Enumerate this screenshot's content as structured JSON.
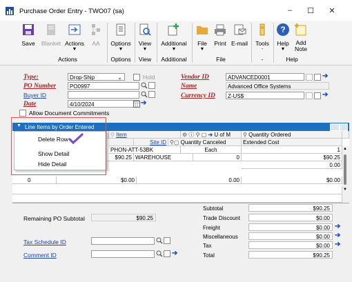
{
  "window": {
    "title": "Purchase Order Entry  -  TWO07 (sa)",
    "minimize": "–",
    "maximize": "☐",
    "close": "✕"
  },
  "ribbon": {
    "buttons": [
      {
        "label": "Save",
        "icon": "save-icon"
      },
      {
        "label": "Blanket",
        "icon": "blanket-icon"
      },
      {
        "label": "Actions",
        "icon": "actions-icon"
      },
      {
        "label": "AA",
        "icon": "aa-icon"
      },
      {
        "label": "Options",
        "icon": "options-icon"
      },
      {
        "label": "View",
        "icon": "view-icon"
      },
      {
        "label": "Additional",
        "icon": "additional-icon"
      },
      {
        "label": "File",
        "icon": "folder-icon"
      },
      {
        "label": "Print",
        "icon": "printer-icon"
      },
      {
        "label": "E-mail",
        "icon": "email-icon"
      },
      {
        "label": "Tools",
        "icon": "tools-icon"
      },
      {
        "label": "Help",
        "icon": "help-icon"
      },
      {
        "label": "Add Note",
        "icon": "add-note-icon"
      }
    ],
    "groups": [
      "Actions",
      "Options",
      "View",
      "Additional",
      "File",
      "-",
      "Help"
    ]
  },
  "header": {
    "type_label": "Type:",
    "type_value": "Drop-Ship",
    "hold_label": "Hold",
    "po_number_label": "PO Number",
    "po_number_value": "PO0997",
    "buyer_label": "Buyer ID",
    "buyer_value": "",
    "date_label": "Date",
    "date_value": "4/10/2024",
    "allow_commitments_label": "Allow Document Commitments",
    "vendor_label": "Vendor ID",
    "vendor_value": "ADVANCED0001",
    "name_label": "Name",
    "name_value": "Advanced Office Systems",
    "currency_label": "Currency ID",
    "currency_value": "Z-US$"
  },
  "grid": {
    "bar_title": "Line Items by Order Entered",
    "headers_row1": [
      "ID",
      "Item",
      "U of M",
      "Quantity Ordered"
    ],
    "headers_row2": [
      "Site ID",
      "Quantity Canceled",
      "Extended Cost"
    ],
    "rows": [
      {
        "item": "PHON-ATT-53BK",
        "uom": "Each",
        "qty": "1"
      },
      {
        "cost_left": "$90.25",
        "site": "WAREHOUSE",
        "qty_canceled": "0",
        "ext_cost": "$90.25"
      },
      {
        "ext2": "0.00"
      },
      {
        "line": "0",
        "cost_left": "$0.00",
        "qty_canceled": "0.00",
        "ext_cost": "$0.00"
      }
    ]
  },
  "context_menu": {
    "items": [
      "Delete Row",
      "Show Detail",
      "Hide Detail"
    ]
  },
  "totals": {
    "remaining_label": "Remaining PO Subtotal",
    "remaining_value": "$90.25",
    "subtotal_label": "Subtotal",
    "subtotal_value": "$90.25",
    "trade_discount_label": "Trade Discount",
    "trade_discount_value": "$0.00",
    "freight_label": "Freight",
    "freight_value": "$0.00",
    "misc_label": "Miscellaneous",
    "misc_value": "$0.00",
    "tax_label": "Tax",
    "tax_value": "$0.00",
    "total_label": "Total",
    "total_value": "$90.25",
    "tax_schedule_label": "Tax Schedule ID",
    "comment_label": "Comment ID"
  }
}
